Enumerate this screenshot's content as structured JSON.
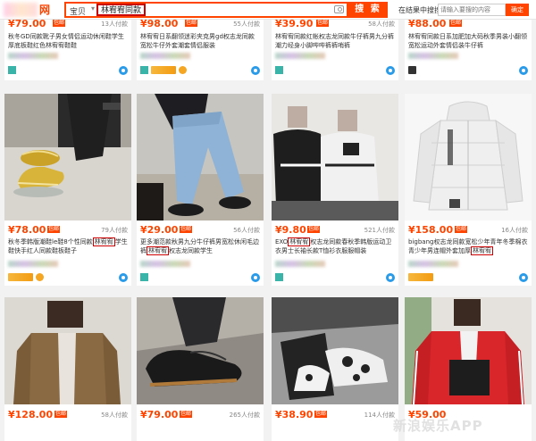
{
  "header": {
    "logo_text": "网",
    "scope_label": "宝贝",
    "query": "林宥宥同款",
    "search_button": "搜 索",
    "in_results_label": "在结果中搜搜",
    "in_results_placeholder": "请输入要搜的内容",
    "confirm_button": "确定"
  },
  "products": [
    {
      "price": "79.00",
      "tag": "包邮",
      "sold": "13人付款",
      "title": "秋冬GD同款靴子男女情侣运动休闲鞋学生厚底板鞋红色林宥宥鞋鞋",
      "location": ""
    },
    {
      "price": "98.00",
      "tag": "包邮",
      "sold": "55人付款",
      "title": "林宥宥日系翻领迷彩夹克男gd权志龙同款宽松牛仔外套潮套情侣服装",
      "location": ""
    },
    {
      "price": "39.90",
      "tag": "包邮",
      "sold": "58人付款",
      "title": "林宥宥同款红帐权志龙同款牛仔裤男九分裤潮力经身小脚哔哔裤裤哨裤",
      "location": ""
    },
    {
      "price": "88.00",
      "tag": "包邮",
      "sold": "",
      "title": "林宥宥同款日系加肥加大码秋季男装小翻领宽松运动外套情侣装牛仔裤",
      "location": ""
    },
    {
      "price": "78.00",
      "tag": "包邮",
      "sold": "79人付款",
      "title": "秋冬季韩版潮鞋le鞋8个性同款",
      "keyword": "林宥宥",
      "title_tail": "学生鞋快手红人同款鞋板鞋子",
      "location": "广东 广州"
    },
    {
      "price": "29.00",
      "tag": "包邮",
      "sold": "56人付款",
      "title": "更多潮范款秋男九分牛仔裤男宽松休闲毛边裤",
      "keyword": "林宥宥",
      "title_tail": "权志龙同款学生",
      "location": "广东 广州"
    },
    {
      "price": "9.80",
      "tag": "包邮",
      "sold": "521人付款",
      "title": "EXO",
      "keyword": "林宥宥",
      "title_tail": "权志龙同款春秋季韩版运动卫衣男士长袖长款T恤衫衣服服帽装",
      "location": "广东 广州"
    },
    {
      "price": "158.00",
      "tag": "包邮",
      "sold": "16人付款",
      "title": "bigbang权志龙同款宽松少年青年冬季棉衣青少年男连帽外套加厚",
      "keyword": "林宥宥",
      "title_tail": "",
      "location": "浙江 杭州"
    },
    {
      "price": "128.00",
      "tag": "包邮",
      "sold": "58人付款",
      "title": "",
      "location": ""
    },
    {
      "price": "79.00",
      "tag": "包邮",
      "sold": "265人付款",
      "title": "",
      "location": ""
    },
    {
      "price": "38.90",
      "tag": "包邮",
      "sold": "114人付款",
      "title": "",
      "location": ""
    },
    {
      "price": "59.00",
      "tag": "包邮",
      "sold": "",
      "title": "",
      "location": ""
    }
  ],
  "watermark": "新浪娱乐APP"
}
